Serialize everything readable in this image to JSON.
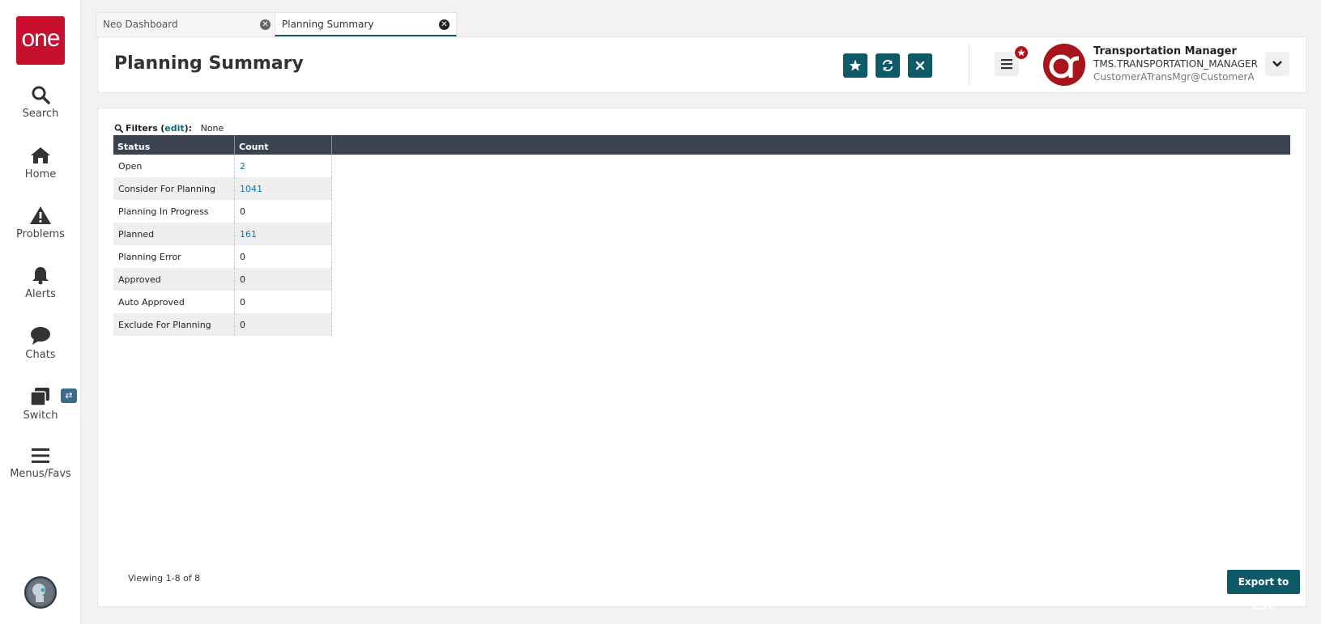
{
  "sidebar": {
    "logo_text": "one",
    "items": [
      {
        "label": "Search",
        "icon": "search-icon"
      },
      {
        "label": "Home",
        "icon": "home-icon"
      },
      {
        "label": "Problems",
        "icon": "warning-icon"
      },
      {
        "label": "Alerts",
        "icon": "bell-icon"
      },
      {
        "label": "Chats",
        "icon": "chat-bubble-icon"
      },
      {
        "label": "Switch",
        "icon": "switch-window-icon"
      },
      {
        "label": "Menus/Favs",
        "icon": "hamburger-icon"
      }
    ]
  },
  "tabs": [
    {
      "label": "Neo Dashboard",
      "active": false
    },
    {
      "label": "Planning Summary",
      "active": true
    }
  ],
  "header": {
    "title": "Planning Summary",
    "actions": [
      {
        "icon": "star-icon"
      },
      {
        "icon": "refresh-icon"
      },
      {
        "icon": "close-icon"
      }
    ]
  },
  "user": {
    "name": "Transportation Manager",
    "role": "TMS.TRANSPORTATION_MANAGER",
    "email": "CustomerATransMgr@CustomerA"
  },
  "filters": {
    "label": "Filters",
    "edit_label": "edit",
    "value": "None"
  },
  "table": {
    "columns": [
      "Status",
      "Count"
    ],
    "rows": [
      {
        "status": "Open",
        "count": "2",
        "link": true
      },
      {
        "status": "Consider For Planning",
        "count": "1041",
        "link": true
      },
      {
        "status": "Planning In Progress",
        "count": "0",
        "link": false
      },
      {
        "status": "Planned",
        "count": "161",
        "link": true
      },
      {
        "status": "Planning Error",
        "count": "0",
        "link": false
      },
      {
        "status": "Approved",
        "count": "0",
        "link": false
      },
      {
        "status": "Auto Approved",
        "count": "0",
        "link": false
      },
      {
        "status": "Exclude For Planning",
        "count": "0",
        "link": false
      }
    ]
  },
  "footer": {
    "viewing": "Viewing 1-8 of 8",
    "export_label": "Export to CSV"
  },
  "colors": {
    "accent": "#0e5a68",
    "brand_red": "#c8102e",
    "table_header": "#3c4350",
    "link": "#1a6fa8"
  }
}
